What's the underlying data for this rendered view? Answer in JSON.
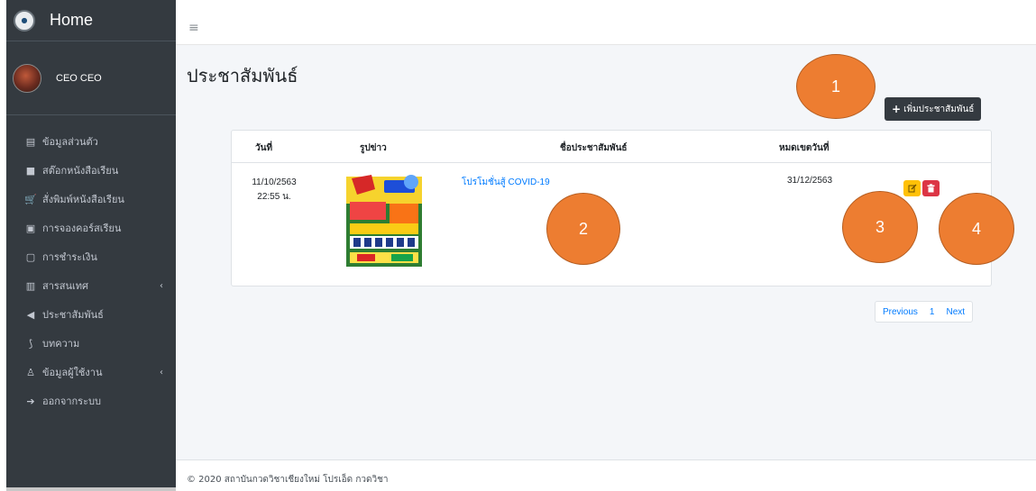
{
  "sidebar": {
    "brand": {
      "title": "Home",
      "logo_text": "●"
    },
    "user": {
      "name": "CEO CEO"
    },
    "items": [
      {
        "icon": "▤",
        "icon_name": "id-card-icon",
        "label": "ข้อมูลส่วนตัว"
      },
      {
        "icon": "■",
        "icon_name": "book-stock-icon",
        "label": "สต๊อกหนังสือเรียน"
      },
      {
        "icon": "🛒",
        "icon_name": "cart-icon",
        "label": "สั่งพิมพ์หนังสือเรียน"
      },
      {
        "icon": "▣",
        "icon_name": "file-icon",
        "label": "การจองคอร์สเรียน"
      },
      {
        "icon": "▢",
        "icon_name": "money-icon",
        "label": "การชำระเงิน"
      },
      {
        "icon": "▥",
        "icon_name": "chart-icon",
        "label": "สารสนเทศ",
        "caret": "‹"
      },
      {
        "icon": "◀",
        "icon_name": "megaphone-icon",
        "label": "ประชาสัมพันธ์"
      },
      {
        "icon": "⟆",
        "icon_name": "rss-icon",
        "label": "บทความ"
      },
      {
        "icon": "♙",
        "icon_name": "user-icon",
        "label": "ข้อมูลผู้ใช้งาน",
        "caret": "‹"
      },
      {
        "icon": "➔",
        "icon_name": "sign-out-icon",
        "label": "ออกจากระบบ"
      }
    ]
  },
  "topbar": {
    "menu_icon": "≡"
  },
  "main": {
    "title": "ประชาสัมพันธ์",
    "add_button": {
      "icon": "+",
      "label": "เพิ่มประชาสัมพันธ์"
    },
    "table": {
      "headers": [
        "วันที่",
        "รูปข่าว",
        "ชื่อประชาสัมพันธ์",
        "หมดเขตวันที่"
      ],
      "rows": [
        {
          "date": "11/10/2563",
          "time": "22:55 น.",
          "title": "โปรโมชั่นสู้ COVID-19",
          "expiry": "31/12/2563"
        }
      ]
    },
    "pagination": {
      "previous": "Previous",
      "page": "1",
      "next": "Next"
    }
  },
  "footer": {
    "text": "© 2020 สถาบันกวดวิชาเชียงใหม่ โปรเอ็ด กวดวิชา"
  },
  "annotations": [
    "1",
    "2",
    "3",
    "4"
  ],
  "colors": {
    "sidebar_bg": "#343a40",
    "content_bg": "#f4f6f9",
    "link": "#007bff",
    "edit": "#ffc107",
    "delete": "#dc3545",
    "marker": "#ed7d31"
  }
}
